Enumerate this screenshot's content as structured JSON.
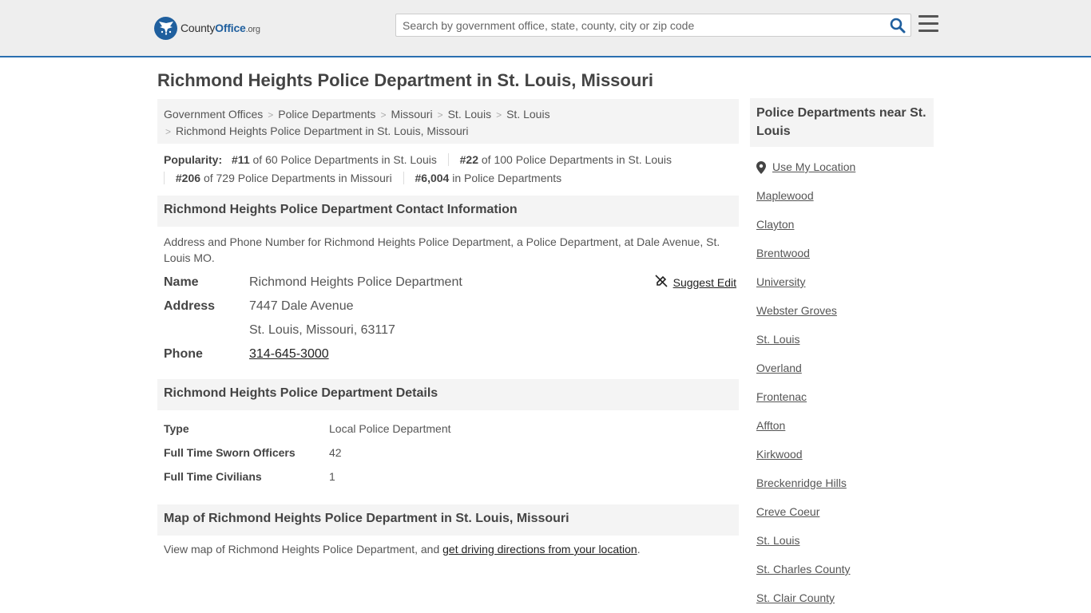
{
  "header": {
    "logo_main": "County",
    "logo_accent": "Office",
    "logo_suffix": ".org",
    "search_placeholder": "Search by government office, state, county, city or zip code"
  },
  "page_title": "Richmond Heights Police Department in St. Louis, Missouri",
  "breadcrumb": [
    "Government Offices",
    "Police Departments",
    "Missouri",
    "St. Louis",
    "St. Louis",
    "Richmond Heights Police Department in St. Louis, Missouri"
  ],
  "popularity": {
    "label": "Popularity:",
    "items": [
      {
        "rank": "#11",
        "text": "of 60 Police Departments in St. Louis"
      },
      {
        "rank": "#22",
        "text": "of 100 Police Departments in St. Louis"
      },
      {
        "rank": "#206",
        "text": "of 729 Police Departments in Missouri"
      },
      {
        "rank": "#6,004",
        "text": "in Police Departments"
      }
    ]
  },
  "contact": {
    "heading": "Richmond Heights Police Department Contact Information",
    "description": "Address and Phone Number for Richmond Heights Police Department, a Police Department, at Dale Avenue, St. Louis MO.",
    "suggest_edit": "Suggest Edit",
    "name_label": "Name",
    "name": "Richmond Heights Police Department",
    "address_label": "Address",
    "address_line1": "7447 Dale Avenue",
    "address_line2": "St. Louis, Missouri, 63117",
    "phone_label": "Phone",
    "phone": "314-645-3000"
  },
  "details": {
    "heading": "Richmond Heights Police Department Details",
    "rows": [
      {
        "label": "Type",
        "value": "Local Police Department"
      },
      {
        "label": "Full Time Sworn Officers",
        "value": "42"
      },
      {
        "label": "Full Time Civilians",
        "value": "1"
      }
    ]
  },
  "map": {
    "heading": "Map of Richmond Heights Police Department in St. Louis, Missouri",
    "text": "View map of Richmond Heights Police Department, and",
    "link": "get driving directions from your location",
    "end": "."
  },
  "sidebar": {
    "heading": "Police Departments near St. Louis",
    "use_location": "Use My Location",
    "links": [
      "Maplewood",
      "Clayton",
      "Brentwood",
      "University",
      "Webster Groves",
      "St. Louis",
      "Overland",
      "Frontenac",
      "Affton",
      "Kirkwood",
      "Breckenridge Hills",
      "Creve Coeur",
      "St. Louis",
      "St. Charles County",
      "St. Clair County"
    ]
  },
  "colors": {
    "brand_blue": "#1f5f9e",
    "header_bg": "#eeeeee",
    "panel_bg": "#f4f4f4"
  }
}
